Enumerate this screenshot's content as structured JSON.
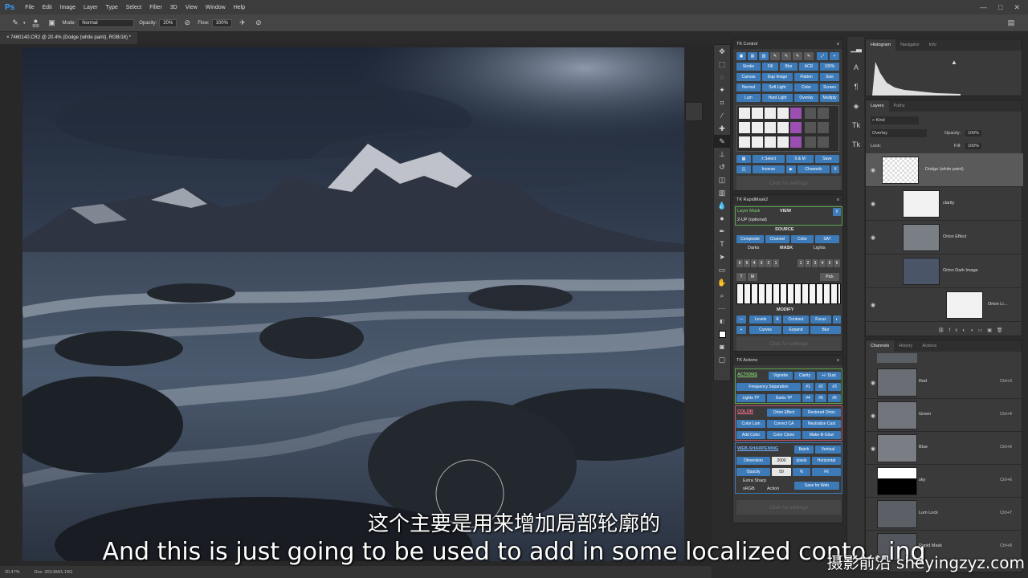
{
  "app": {
    "logo": "Ps",
    "menu": [
      "File",
      "Edit",
      "Image",
      "Layer",
      "Type",
      "Select",
      "Filter",
      "3D",
      "View",
      "Window",
      "Help"
    ]
  },
  "options": {
    "brush_size": "900",
    "mode_label": "Mode:",
    "mode_value": "Normal",
    "opacity_label": "Opacity:",
    "opacity_value": "20%",
    "flow_label": "Flow:",
    "flow_value": "100%"
  },
  "document": {
    "tab_title": "× 7460140.CR2 @ 20.4% (Dodge (white paint), RGB/16) *"
  },
  "status": {
    "zoom": "20.47%",
    "doc_size": "Doc: 203.6M/1.19G"
  },
  "tk_control": {
    "title": "TK Control",
    "row1": [
      "Stroke",
      "Fill",
      "Blur",
      "ACR",
      "100%"
    ],
    "row2": [
      "Canvas",
      "Dup Image",
      "Flatten",
      "Size"
    ],
    "row3": [
      "Normal",
      "Soft Light",
      "Color",
      "Screen"
    ],
    "row4": [
      "Lum",
      "Hard Light",
      "Overlay",
      "Multiply"
    ],
    "select": "± Select",
    "sm": "S & M",
    "save": "Save",
    "inverse": "Inverse",
    "channels": "Channels",
    "x": "X",
    "settings": "Click for settings"
  },
  "rapidmask": {
    "title": "TK RapidMask2",
    "layer_mask": "Layer Mask",
    "view": "VIEW",
    "twoup": "2-UP (optional)",
    "source": "SOURCE",
    "source_btns": [
      "Composite",
      "Channel",
      "Color",
      "SAT"
    ],
    "darks": "Darks",
    "mask": "MASK",
    "lights": "Lights",
    "nums_left": [
      "6",
      "5",
      "4",
      "3",
      "2",
      "1"
    ],
    "nums_right": [
      "1",
      "2",
      "3",
      "4",
      "5",
      "6"
    ],
    "t": "T",
    "m": "M",
    "pick": "Pick",
    "modify": "MODIFY",
    "modify_row1": [
      "Levels",
      "A",
      "Contract",
      "Focus"
    ],
    "modify_row2": [
      "Curves",
      "Expand",
      "Blur"
    ],
    "settings": "Click for settings"
  },
  "tk_actions": {
    "title": "TK Actions",
    "actions_label": "ACTIONS",
    "actions_row1": [
      "Vignette",
      "Clarity",
      "+/- Dust"
    ],
    "actions_row2": [
      "Frequency Separation",
      "#1",
      "#2",
      "#3"
    ],
    "actions_row3": [
      "Lights TP",
      "Darks TP",
      "#4",
      "#5",
      "#6"
    ],
    "color_label": "COLOR",
    "color_row1": [
      "Orton Effect",
      "Restored Orton"
    ],
    "color_row2": [
      "Color Lum",
      "Correct CA",
      "Neutralize Cast"
    ],
    "color_row3": [
      "Add Color",
      "Color Clone",
      "Make-B-Glow"
    ],
    "web_label": "WEB-SHARPENING",
    "web_batch": "Batch",
    "web_vertical": "Vertical",
    "dimension_label": "Dimension",
    "dimension_value": "2000",
    "pixels": "pixels",
    "horizontal": "Horizontal",
    "opacity_label": "Opacity",
    "opacity_value": "50",
    "percent": "%",
    "fit": "Fit",
    "extra_sharp": "Extra Sharp",
    "srgb": "sRGB",
    "action": "Action",
    "save_web": "Save for Web",
    "settings": "Click for settings"
  },
  "right_panels": {
    "top_tabs": [
      "Histogram",
      "Navigator",
      "Info"
    ],
    "layers_tabs": [
      "Layers",
      "Paths"
    ],
    "kind": "Kind",
    "blend_mode": "Overlay",
    "opacity_label": "Opacity:",
    "opacity_value": "100%",
    "lock_label": "Lock:",
    "fill_label": "Fill:",
    "fill_value": "100%",
    "layers": [
      {
        "name": "Dodge (white paint)"
      },
      {
        "name": "clarity"
      },
      {
        "name": "Orton Effect"
      },
      {
        "name": "Orton Dark Image"
      },
      {
        "name": "Orton Li..."
      }
    ],
    "channel_tabs": [
      "Channels",
      "History",
      "Actions"
    ],
    "channels": [
      {
        "name": "Red",
        "key": "Ctrl+3"
      },
      {
        "name": "Green",
        "key": "Ctrl+4"
      },
      {
        "name": "Blue",
        "key": "Ctrl+5"
      },
      {
        "name": "sky",
        "key": "Ctrl+6"
      },
      {
        "name": "Lum Lock",
        "key": "Ctrl+7"
      },
      {
        "name": "Rapid Mask",
        "key": "Ctrl+8"
      }
    ]
  },
  "subtitles": {
    "chinese": "这个主要是用来增加局部轮廓的",
    "english": "And this is just going to be used to add in some localized conto...ing"
  },
  "watermark": "摄影前沿 sheyingzyz.com"
}
